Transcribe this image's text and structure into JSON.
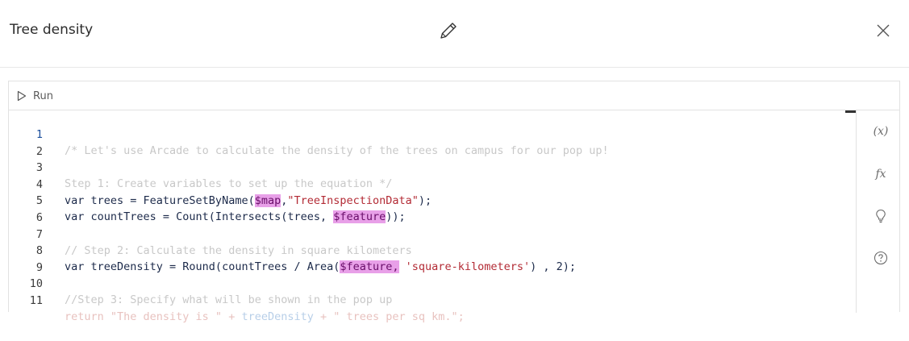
{
  "header": {
    "title": "Tree density"
  },
  "toolbar": {
    "run_label": "Run"
  },
  "code": {
    "line_numbers": [
      "1",
      "2",
      "3",
      "4",
      "5",
      "6",
      "7",
      "8",
      "9",
      "10",
      "11"
    ],
    "lines": {
      "l1": "/* Let's use Arcade to calculate the density of the trees on campus for our pop up!",
      "l3": "Step 1: Create variables to set up the equation */",
      "l4a": "var trees = FeatureSetByName(",
      "l4b": "$map",
      "l4c": ",",
      "l4d": "\"TreeInspectionData\"",
      "l4e": ");",
      "l5a": "var countTrees = Count(Intersects(trees, ",
      "l5b": "$feature",
      "l5c": "));",
      "l7": "// Step 2: Calculate the density in square kilometers",
      "l8a": "var treeDensity = Round(countTrees / Area(",
      "l8b": "$feature,",
      "l8c": " ",
      "l8d": "'square-kilometers'",
      "l8e": ") , 2);",
      "l10": "//Step 3: Specify what will be shown in the pop up",
      "l11a": "return \"The density is \" + ",
      "l11b": "treeDensity",
      "l11c": " + \" trees per sq km.\";"
    }
  },
  "side_panel": {
    "variables_icon": "(x)",
    "functions_icon": "fx"
  },
  "colors": {
    "accent": "#1c4f9c",
    "highlight": "#e8a0e8"
  }
}
